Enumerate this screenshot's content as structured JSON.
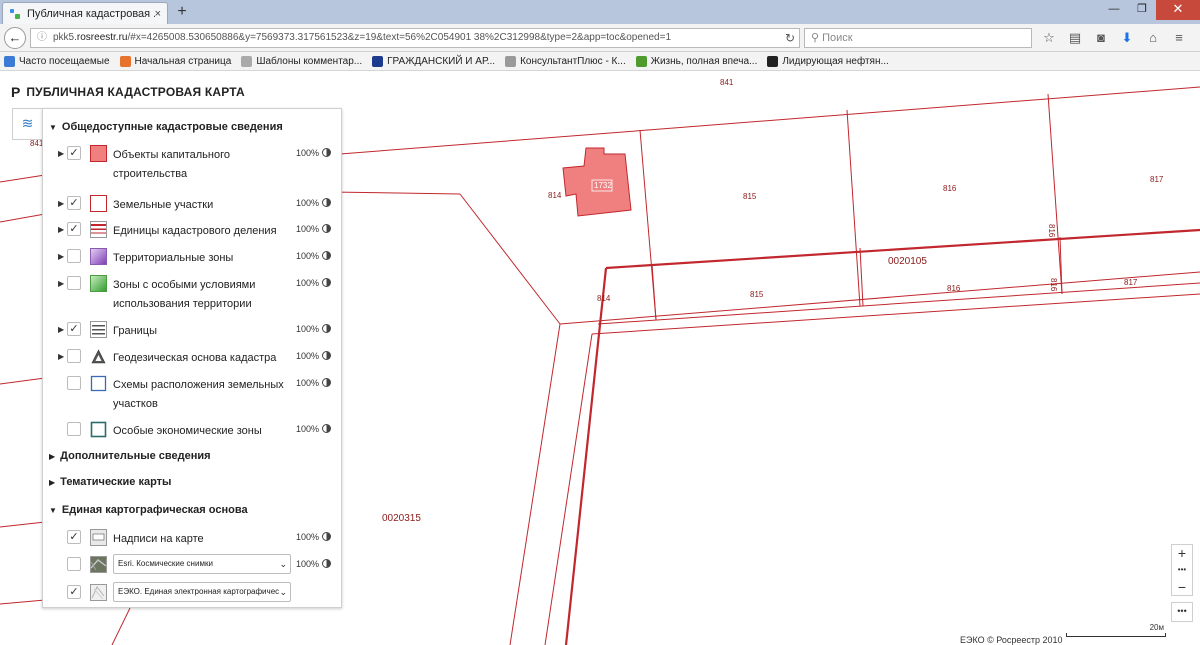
{
  "browser": {
    "tab_title": "Публичная кадастровая ...",
    "tab_close": "×",
    "new_tab": "+",
    "window_buttons": {
      "minimize": "—",
      "restore": "❐",
      "close": "✕"
    },
    "url_prefix": "pkk5.",
    "url_host": "rosreestr.ru",
    "url_rest": "/#x=4265008.530650886&y=7569373.317561523&z=19&text=56%2C054901 38%2C312998&type=2&app=toc&opened=1",
    "search_placeholder": "Поиск",
    "bookmarks": [
      {
        "label": "Часто посещаемые",
        "color": "#3b7bd6"
      },
      {
        "label": "Начальная страница",
        "color": "#e8722b"
      },
      {
        "label": "Шаблоны комментар...",
        "color": "#aaaaaa"
      },
      {
        "label": "ГРАЖДАНСКИЙ И АР...",
        "color": "#1d3b8c"
      },
      {
        "label": "КонсультантПлюс - К...",
        "color": "#9a9a9a"
      },
      {
        "label": "Жизнь, полная впеча...",
        "color": "#4e9a2d"
      },
      {
        "label": "Лидирующая нефтян...",
        "color": "#222222"
      }
    ]
  },
  "app": {
    "logo": "Р",
    "title": "ПУБЛИЧНАЯ КАДАСТРОВАЯ КАРТА"
  },
  "panel": {
    "section_public": "Общедоступные кадастровые сведения",
    "layers": [
      {
        "label": "Объекты капитального строительства",
        "checked": true,
        "expandable": true,
        "opacity": "100%",
        "swatch": "building"
      },
      {
        "label": "Земельные участки",
        "checked": true,
        "expandable": true,
        "opacity": "100%",
        "swatch": "parcel"
      },
      {
        "label": "Единицы кадастрового деления",
        "checked": true,
        "expandable": true,
        "opacity": "100%",
        "swatch": "units"
      },
      {
        "label": "Территориальные зоны",
        "checked": false,
        "expandable": true,
        "opacity": "100%",
        "swatch": "zones"
      },
      {
        "label": "Зоны с особыми условиями использования территории",
        "checked": false,
        "expandable": true,
        "opacity": "100%",
        "swatch": "special"
      },
      {
        "label": "Границы",
        "checked": true,
        "expandable": true,
        "opacity": "100%",
        "swatch": "borders"
      },
      {
        "label": "Геодезическая основа кадастра",
        "checked": false,
        "expandable": true,
        "opacity": "100%",
        "swatch": "geodesy"
      },
      {
        "label": "Схемы расположения земельных участков",
        "checked": false,
        "expandable": false,
        "opacity": "100%",
        "swatch": "schemes"
      },
      {
        "label": "Особые экономические зоны",
        "checked": false,
        "expandable": false,
        "opacity": "100%",
        "swatch": "sez"
      }
    ],
    "section_additional": "Дополнительные сведения",
    "section_thematic": "Тематические карты",
    "section_basemap": "Единая картографическая основа",
    "basemap": {
      "labels_layer": "Надписи на карте",
      "labels_opacity": "100%",
      "satellite_select": "Esri. Космические снимки",
      "satellite_opacity": "100%",
      "ecko_select": "ЕЭКО. Единая электронная картографичес"
    }
  },
  "map": {
    "labels": {
      "l841_top": "841",
      "l841_left": "841",
      "l814_a": "814",
      "l815_a": "815",
      "l816_a": "816",
      "l817_a": "817",
      "l816_rot_a": "816",
      "block_20105": "0020105",
      "l814_b": "814",
      "l815_b": "815",
      "l816_b": "816",
      "l816_rot_b": "816",
      "l817_b": "817",
      "block_20315": "0020315",
      "building": "1732"
    },
    "colors": {
      "border": "#c1272d",
      "building_fill": "#f08080"
    },
    "zoom_in": "+",
    "zoom_more": "•••",
    "zoom_out": "−",
    "more": "•••",
    "attribution": "ЕЭКО © Росреестр 2010",
    "scale_label": "20м"
  }
}
